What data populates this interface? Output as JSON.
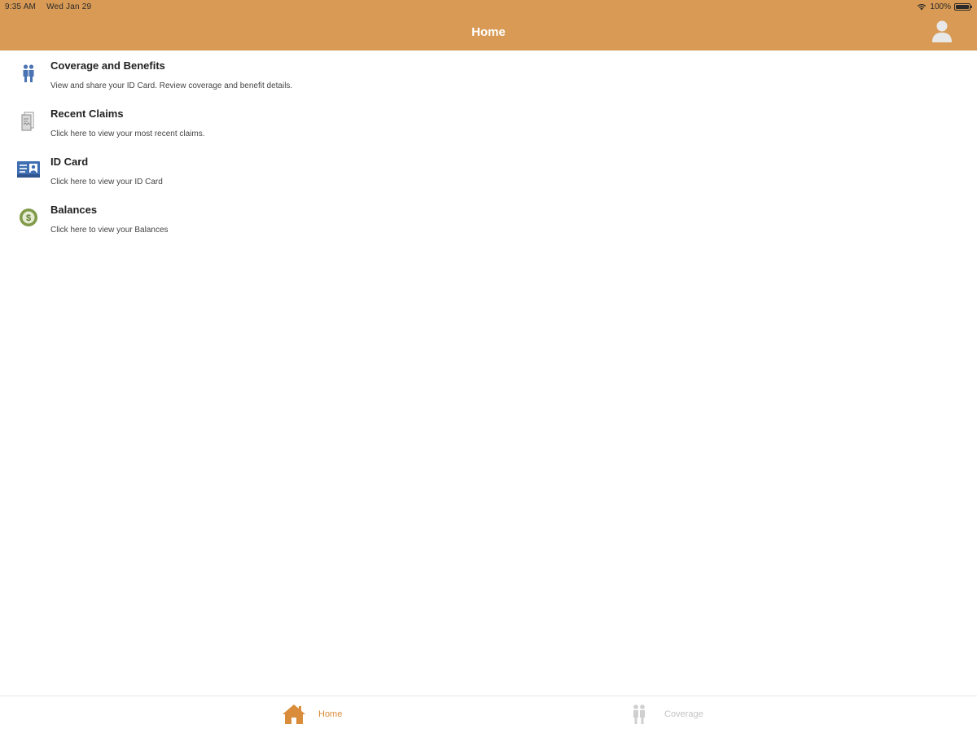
{
  "status_bar": {
    "time": "9:35 AM",
    "date": "Wed Jan 29",
    "battery": "100%"
  },
  "header": {
    "title": "Home",
    "background_color": "#D89A55",
    "profile_icon": "user-avatar-icon"
  },
  "menu": {
    "items": [
      {
        "icon": "coverage-people-icon",
        "title": "Coverage and Benefits",
        "description": "View and share your ID Card. Review coverage and benefit details."
      },
      {
        "icon": "claims-document-icon",
        "title": "Recent Claims",
        "description": "Click here to view your most recent claims."
      },
      {
        "icon": "id-card-icon",
        "title": "ID Card",
        "description": "Click here to view your ID Card"
      },
      {
        "icon": "dollar-coin-icon",
        "title": "Balances",
        "description": "Click here to view your Balances"
      }
    ]
  },
  "tabbar": {
    "tabs": [
      {
        "label": "Home",
        "icon": "home-icon",
        "active": true,
        "color": "#D98C3A"
      },
      {
        "label": "Coverage",
        "icon": "coverage-people-icon",
        "active": false,
        "color": "#c4c4c4"
      }
    ]
  }
}
